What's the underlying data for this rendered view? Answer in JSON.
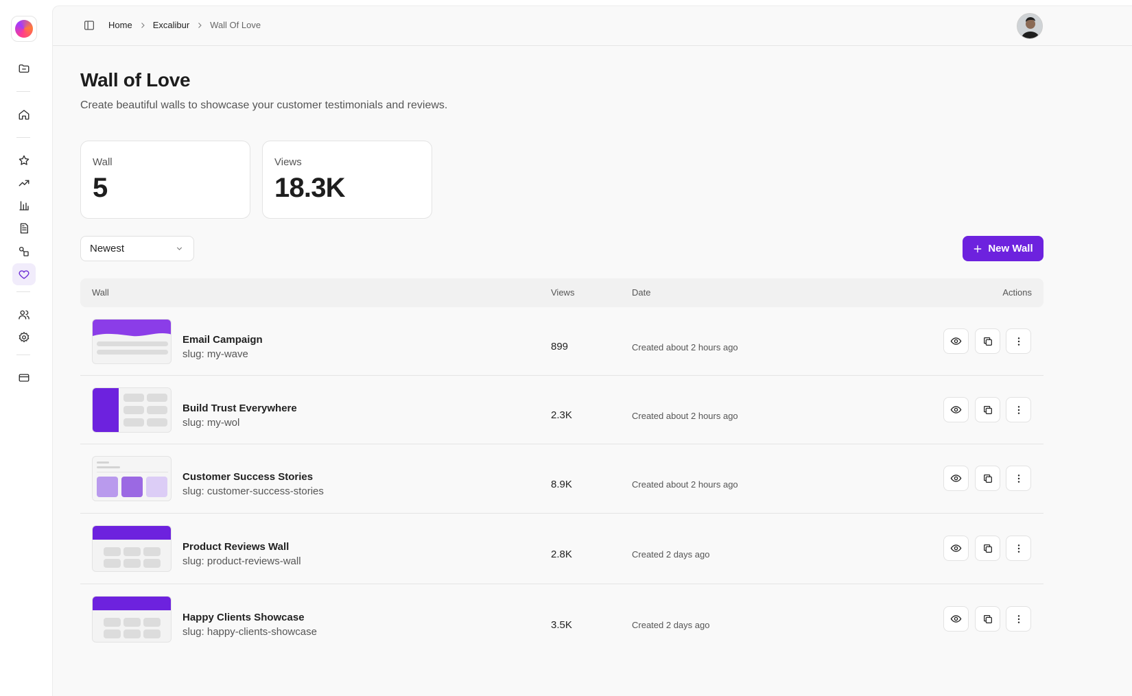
{
  "breadcrumb": {
    "home": "Home",
    "project": "Excalibur",
    "current": "Wall Of Love"
  },
  "page": {
    "title": "Wall of Love",
    "subtitle": "Create beautiful walls to showcase your customer testimonials and reviews."
  },
  "stats": [
    {
      "label": "Wall",
      "value": "5"
    },
    {
      "label": "Views",
      "value": "18.3K"
    }
  ],
  "controls": {
    "sort_value": "Newest",
    "new_button": "New Wall"
  },
  "table": {
    "headers": {
      "wall": "Wall",
      "views": "Views",
      "date": "Date",
      "actions": "Actions"
    },
    "rows": [
      {
        "name": "Email Campaign",
        "slug": "slug: my-wave",
        "views": "899",
        "date": "Created about 2 hours ago"
      },
      {
        "name": "Build Trust Everywhere",
        "slug": "slug: my-wol",
        "views": "2.3K",
        "date": "Created about 2 hours ago"
      },
      {
        "name": "Customer Success Stories",
        "slug": "slug: customer-success-stories",
        "views": "8.9K",
        "date": "Created about 2 hours ago"
      },
      {
        "name": "Product Reviews Wall",
        "slug": "slug: product-reviews-wall",
        "views": "2.8K",
        "date": "Created 2 days ago"
      },
      {
        "name": "Happy Clients Showcase",
        "slug": "slug: happy-clients-showcase",
        "views": "3.5K",
        "date": "Created 2 days ago"
      }
    ]
  },
  "sidebar": {
    "icons": [
      "folder-icon",
      "home-icon",
      "star-icon",
      "trending-icon",
      "bar-chart-icon",
      "document-icon",
      "shapes-icon",
      "heart-icon",
      "users-icon",
      "settings-icon",
      "credit-card-icon"
    ],
    "active": "heart-icon"
  },
  "colors": {
    "accent": "#6d22de",
    "active_bg": "#f1ecfb"
  }
}
